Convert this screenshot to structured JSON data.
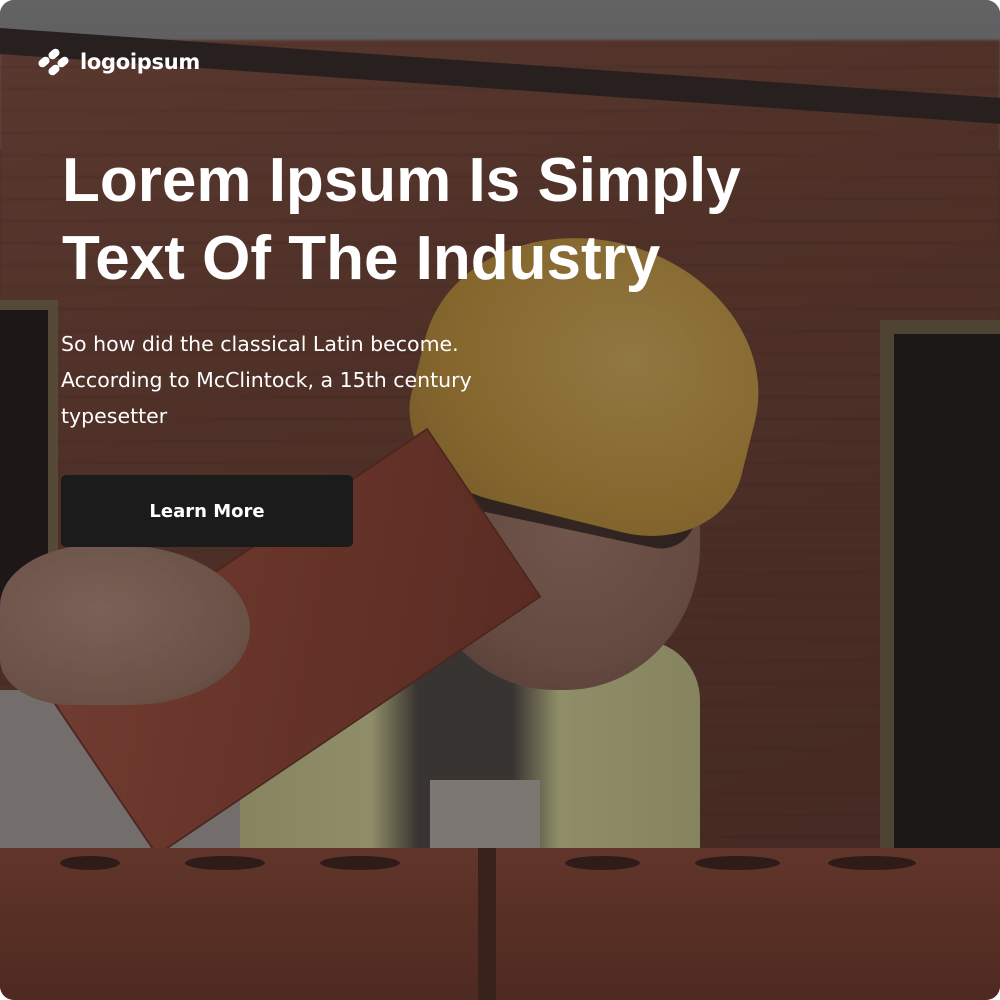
{
  "brand": {
    "logo_icon": "logoipsum-mark-icon",
    "name": "logoipsum"
  },
  "hero": {
    "headline_line1": "Lorem Ipsum Is Simply",
    "headline_line2": "Text Of The Industry",
    "description_line1": "So how did the classical Latin become.",
    "description_line2": "According to McClintock, a 15th century",
    "description_line3": "typesetter",
    "cta_label": "Learn More"
  },
  "colors": {
    "button_background": "#1b1b1b",
    "text": "#ffffff"
  }
}
